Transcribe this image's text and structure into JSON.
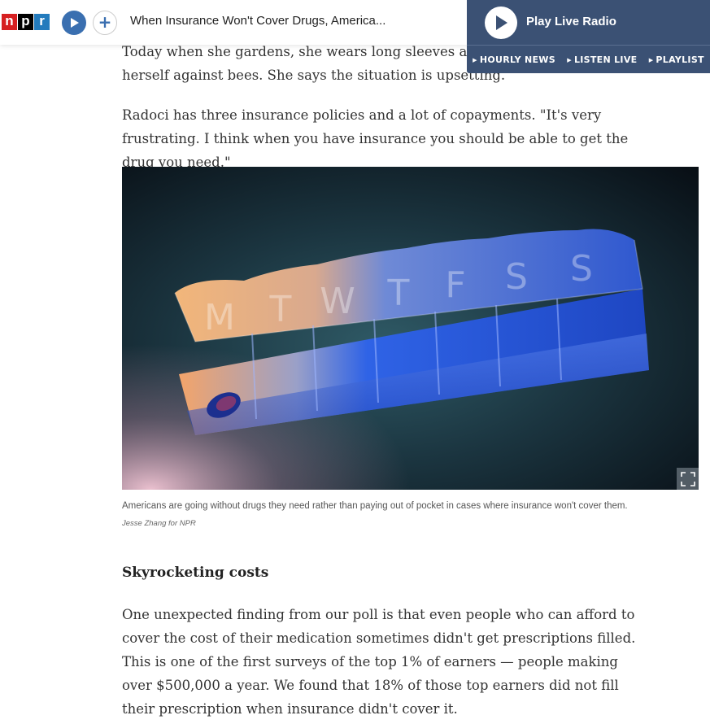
{
  "header": {
    "logo_letters": [
      "n",
      "p",
      "r"
    ],
    "title": "When Insurance Won't Cover Drugs, America..."
  },
  "radio": {
    "label": "Play Live Radio",
    "links": [
      "HOURLY NEWS",
      "LISTEN LIVE",
      "PLAYLIST"
    ]
  },
  "article": {
    "p1": "Today when she gardens, she wears long sleeves and long pants to protect herself against bees. She says the situation is upsetting.",
    "p2": "Radoci has three insurance policies and a lot of copayments. \"It's very frustrating. I think when you have insurance you should be able to get the drug you need.\"",
    "caption": "Americans are going without drugs they need rather than paying out of pocket in cases where insurance won't cover them.",
    "credit": "Jesse Zhang for NPR",
    "subhead": "Skyrocketing costs",
    "p3": "One unexpected finding from our poll is that even people who can afford to cover the cost of their medication sometimes didn't get prescriptions filled. This is one of the first surveys of the top 1% of earners — people making over $500,000 a year. We found that 18% of those top earners did not fill their prescription when insurance didn't cover it."
  },
  "pill_box_letters": [
    "M",
    "T",
    "W",
    "T",
    "F",
    "S",
    "S"
  ],
  "colors": {
    "radio_bg": "#3b5174",
    "npr_red": "#d62021",
    "npr_blue": "#237bbd"
  }
}
